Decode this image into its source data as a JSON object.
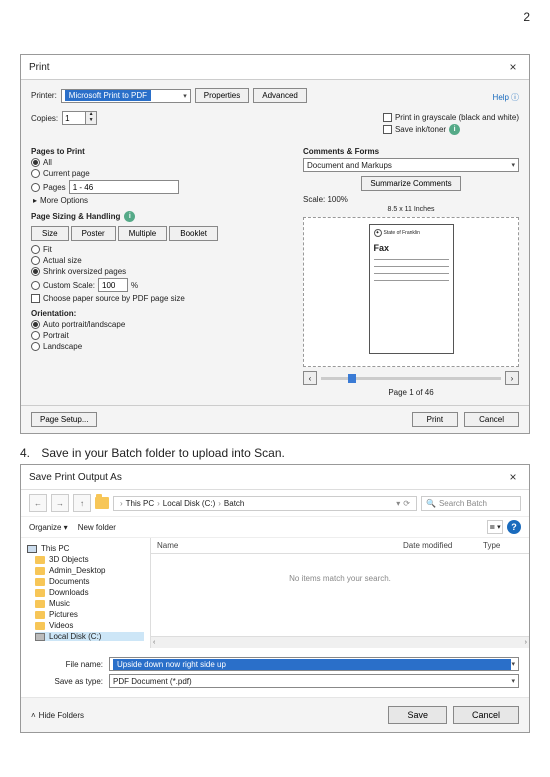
{
  "page_number": "2",
  "print_dialog": {
    "title": "Print",
    "printer_label": "Printer:",
    "printer_value": "Microsoft Print to PDF",
    "properties_btn": "Properties",
    "advanced_btn": "Advanced",
    "help_label": "Help",
    "copies_label": "Copies:",
    "copies_value": "1",
    "grayscale_label": "Print in grayscale (black and white)",
    "saveink_label": "Save ink/toner",
    "pages_to_print": "Pages to Print",
    "all_label": "All",
    "current_label": "Current page",
    "pages_label": "Pages",
    "pages_value": "1 - 46",
    "more_options": "More Options",
    "sizing_head": "Page Sizing & Handling",
    "size_btn": "Size",
    "poster_btn": "Poster",
    "multiple_btn": "Multiple",
    "booklet_btn": "Booklet",
    "fit_label": "Fit",
    "actual_label": "Actual size",
    "shrink_label": "Shrink oversized pages",
    "custom_label": "Custom Scale:",
    "custom_value": "100",
    "percent": "%",
    "choose_paper": "Choose paper source by PDF page size",
    "orientation_head": "Orientation:",
    "auto_orient": "Auto portrait/landscape",
    "portrait": "Portrait",
    "landscape": "Landscape",
    "comments_head": "Comments & Forms",
    "comments_value": "Document and Markups",
    "summarize_btn": "Summarize Comments",
    "scale_label": "Scale: 100%",
    "paper_size": "8.5 x 11 Inches",
    "fax_word": "Fax",
    "seal_text": "State of Franklin",
    "page_of": "Page 1 of 46",
    "page_setup": "Page Setup...",
    "print_btn": "Print",
    "cancel_btn": "Cancel"
  },
  "step4": {
    "number": "4.",
    "text": "Save in your Batch folder to upload into Scan."
  },
  "save_dialog": {
    "title": "Save Print Output As",
    "bc1": "This PC",
    "bc2": "Local Disk (C:)",
    "bc3": "Batch",
    "search_placeholder": "Search Batch",
    "organize": "Organize ▾",
    "newfolder": "New folder",
    "col_name": "Name",
    "col_date": "Date modified",
    "col_type": "Type",
    "empty": "No items match your search.",
    "tree": {
      "thispc": "This PC",
      "obj3d": "3D Objects",
      "admin": "Admin_Desktop",
      "documents": "Documents",
      "downloads": "Downloads",
      "music": "Music",
      "pictures": "Pictures",
      "videos": "Videos",
      "localdisk": "Local Disk (C:)"
    },
    "file_name_label": "File name:",
    "file_name_value": "Upside down now right side up",
    "save_as_type_label": "Save as type:",
    "save_as_type_value": "PDF Document (*.pdf)",
    "hide_folders": "Hide Folders",
    "save_btn": "Save",
    "cancel_btn": "Cancel"
  }
}
